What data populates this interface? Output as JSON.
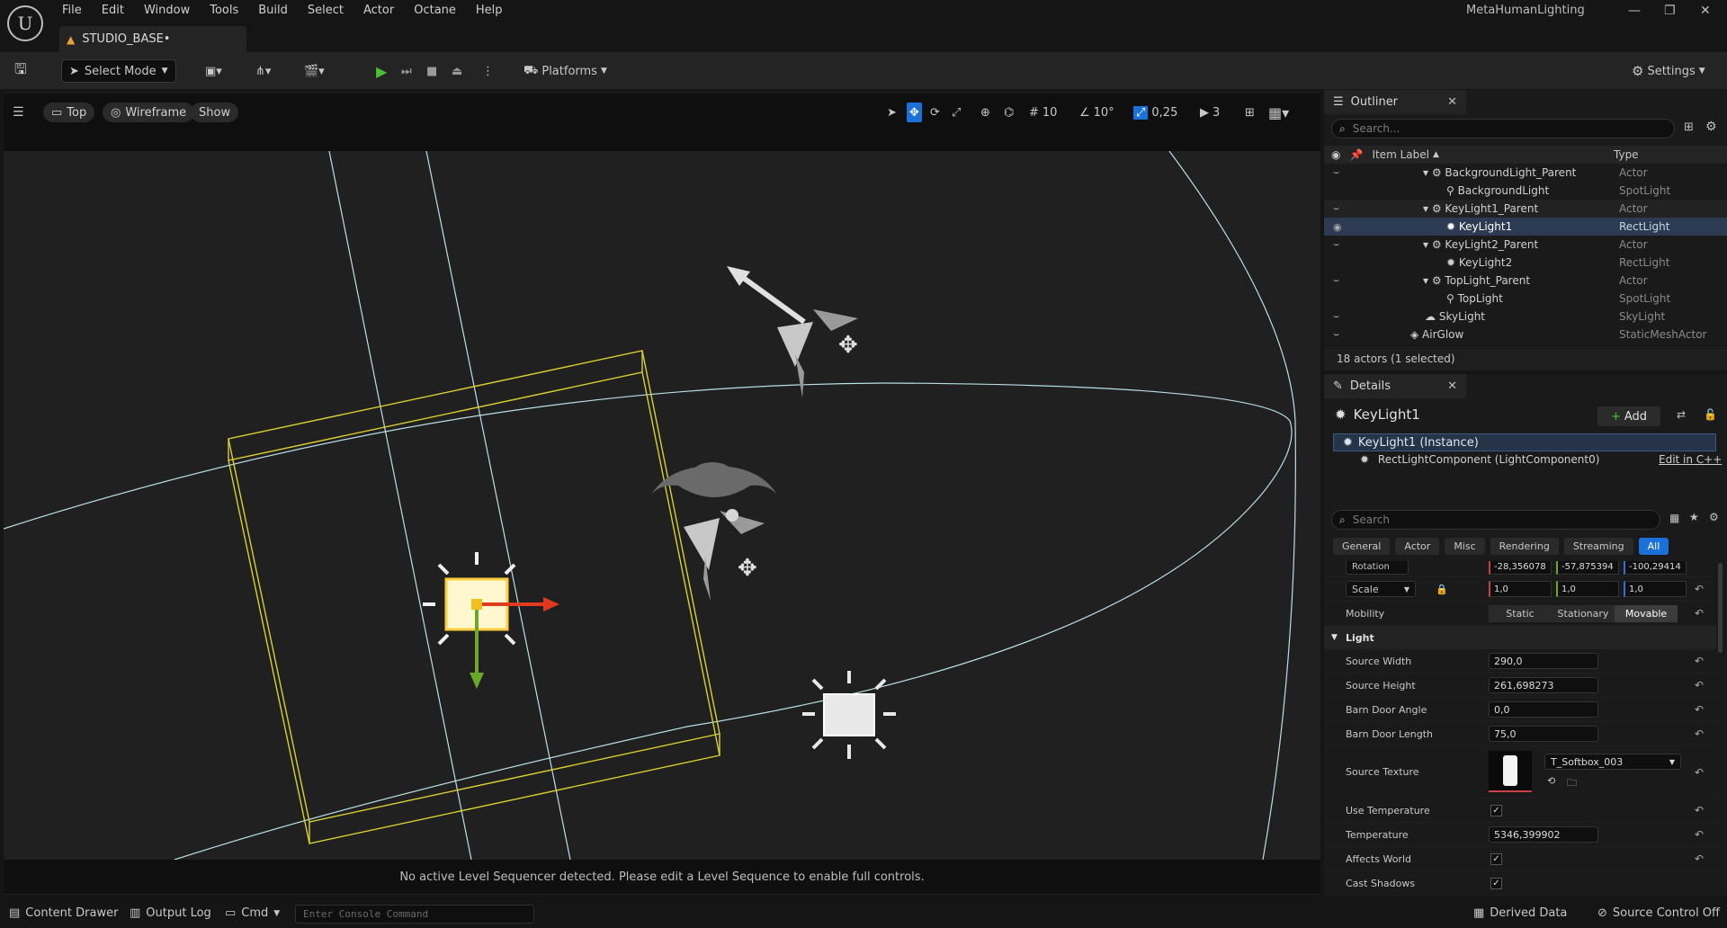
{
  "menu": [
    "File",
    "Edit",
    "Window",
    "Tools",
    "Build",
    "Select",
    "Actor",
    "Octane",
    "Help"
  ],
  "project_name": "MetaHumanLighting",
  "level_tab": "STUDIO_BASE•",
  "toolbar": {
    "select_mode": "Select Mode",
    "platforms": "Platforms",
    "settings": "Settings"
  },
  "viewport": {
    "view": "Top",
    "view_mode": "Wireframe",
    "show": "Show",
    "grid_snap": "10",
    "rotation_snap": "10°",
    "scale_snap": "0,25",
    "camera_speed": "3",
    "message": "No active Level Sequencer detected. Please edit a Level Sequence to enable full controls."
  },
  "outliner": {
    "title": "Outliner",
    "search_placeholder": "Search...",
    "col_label": "Item Label",
    "col_type": "Type",
    "rows": [
      {
        "label": "BackgroundLight_Parent",
        "type": "Actor"
      },
      {
        "label": "BackgroundLight",
        "type": "SpotLight"
      },
      {
        "label": "KeyLight1_Parent",
        "type": "Actor"
      },
      {
        "label": "KeyLight1",
        "type": "RectLight"
      },
      {
        "label": "KeyLight2_Parent",
        "type": "Actor"
      },
      {
        "label": "KeyLight2",
        "type": "RectLight"
      },
      {
        "label": "TopLight_Parent",
        "type": "Actor"
      },
      {
        "label": "TopLight",
        "type": "SpotLight"
      },
      {
        "label": "SkyLight",
        "type": "SkyLight"
      },
      {
        "label": "AirGlow",
        "type": "StaticMeshActor"
      }
    ],
    "count": "18 actors (1 selected)"
  },
  "details": {
    "title": "Details",
    "actor": "KeyLight1",
    "add": "Add",
    "instance": "KeyLight1 (Instance)",
    "component": "RectLightComponent (LightComponent0)",
    "edit_cpp": "Edit in C++",
    "search_placeholder": "Search",
    "filter_tabs": [
      "General",
      "Actor",
      "Misc",
      "Rendering",
      "Streaming",
      "All"
    ],
    "rotation_label": "Rotation",
    "rotation": [
      "-28,356078",
      "-57,875394",
      "-100,29414"
    ],
    "scale_label": "Scale",
    "scale": [
      "1,0",
      "1,0",
      "1,0"
    ],
    "mobility_label": "Mobility",
    "mobility": [
      "Static",
      "Stationary",
      "Movable"
    ],
    "section_light": "Light",
    "source_width_label": "Source Width",
    "source_width": "290,0",
    "source_height_label": "Source Height",
    "source_height": "261,698273",
    "barn_angle_label": "Barn Door Angle",
    "barn_angle": "0,0",
    "barn_length_label": "Barn Door Length",
    "barn_length": "75,0",
    "source_texture_label": "Source Texture",
    "source_texture": "T_Softbox_003",
    "use_temp_label": "Use Temperature",
    "temperature_label": "Temperature",
    "temperature": "5346,399902",
    "affects_world_label": "Affects World",
    "cast_shadows_label": "Cast Shadows"
  },
  "status": {
    "content_drawer": "Content Drawer",
    "output_log": "Output Log",
    "cmd": "Cmd",
    "console_placeholder": "Enter Console Command",
    "derived_data": "Derived Data",
    "source_control": "Source Control Off"
  },
  "colors": {
    "accent": "#1c70d9",
    "selection_box": "#d8d030",
    "wire": "#b8e0e8",
    "gizmo_x": "#e03a1e",
    "gizmo_y": "#6aa82a"
  }
}
